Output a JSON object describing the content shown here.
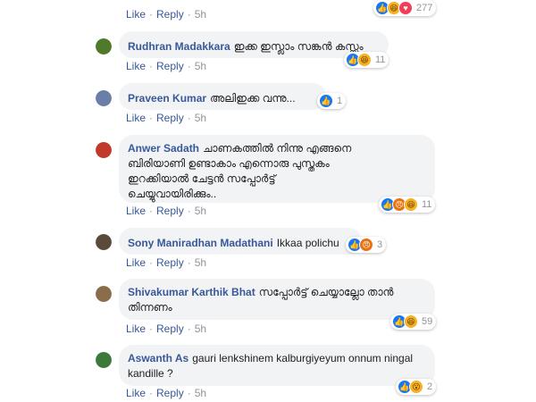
{
  "actions": {
    "like": "Like",
    "reply": "Reply"
  },
  "colors": {
    "link": "#385898",
    "bubble": "#f2f3f5",
    "meta": "#90949c"
  },
  "comments": [
    {
      "name": "",
      "text": "",
      "time": "5h",
      "reactions": [
        "like-icon",
        "haha-icon",
        "love-icon"
      ],
      "reaction_count": "277",
      "avatar_color": ""
    },
    {
      "name": "Rudhran Madakkara",
      "text": "ഇക്ക ഇസ്ലാം സങ്കൻ കസ്സം",
      "time": "5h",
      "reactions": [
        "like-icon",
        "haha-icon"
      ],
      "reaction_count": "11",
      "avatar_color": "#4f7a2a"
    },
    {
      "name": "Praveen Kumar",
      "text": "അലിഇക്ക വന്നു...",
      "time": "5h",
      "reactions": [
        "like-icon"
      ],
      "reaction_count": "1",
      "avatar_color": "#6a7ea8"
    },
    {
      "name": "Anwer Sadath",
      "text": "ചാണകത്തിൽ നിന്നു എങ്ങനെ\nബിരിയാണി ഉണ്ടാകാം എന്നൊരു പുസ്തകം\nഇറക്കിയാൽ ചേട്ടൻ സപ്പോർട്ട്\nചെയ്യുവായിരിക്കും..",
      "time": "5h",
      "reactions": [
        "like-icon",
        "angry-icon",
        "haha-icon"
      ],
      "reaction_count": "11",
      "avatar_color": "#c0392b"
    },
    {
      "name": "Sony Maniradhan Madathani",
      "text": "Ikkaa polichu",
      "time": "5h",
      "reactions": [
        "like-icon",
        "angry-icon"
      ],
      "reaction_count": "3",
      "avatar_color": "#5a4a3a"
    },
    {
      "name": "Shivakumar Karthik Bhat",
      "text": "സപ്പോർട്ട് ചെയ്യാല്ലോ താൻ\nതിന്നണം",
      "time": "5h",
      "reactions": [
        "like-icon",
        "haha-icon"
      ],
      "reaction_count": "59",
      "avatar_color": "#8a6d4a"
    },
    {
      "name": "Aswanth As",
      "text": "gauri lenkshinem kalburgiyeyum onnum ningal\nkandille ?",
      "time": "5h",
      "reactions": [
        "like-icon",
        "wow-icon"
      ],
      "reaction_count": "2",
      "avatar_color": "#3c7a3a"
    }
  ]
}
